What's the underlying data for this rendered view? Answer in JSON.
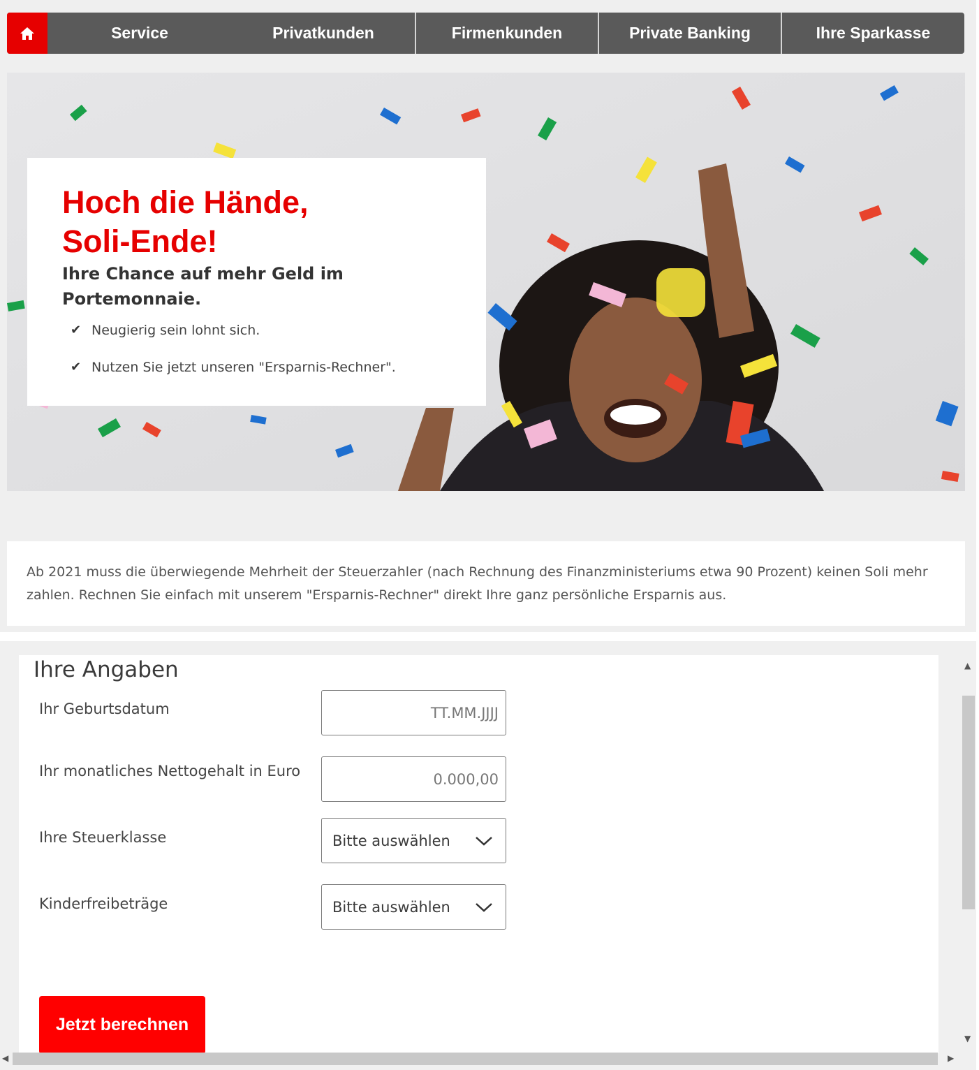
{
  "nav": {
    "home_icon": "home-icon",
    "items": [
      {
        "label": "Service"
      },
      {
        "label": "Privatkunden"
      },
      {
        "label": "Firmenkunden"
      },
      {
        "label": "Private Banking"
      },
      {
        "label": "Ihre Sparkasse"
      }
    ]
  },
  "hero": {
    "image": "woman-with-confetti-photo",
    "headline_line1": "Hoch die Hände,",
    "headline_line2": "Soli-Ende!",
    "subheadline": "Ihre Chance auf mehr Geld im Portemonnaie.",
    "bullets": [
      {
        "icon": "checkmark-icon",
        "text": "Neugierig sein lohnt sich."
      },
      {
        "icon": "checkmark-icon",
        "text": "Nutzen Sie jetzt unseren \"Ersparnis-Rechner\"."
      }
    ]
  },
  "intro": {
    "text": "Ab 2021 muss die überwiegende Mehrheit der Steuerzahler (nach Rechnung des Finanzministeriums etwa 90 Prozent) keinen Soli mehr zahlen. Rechnen Sie einfach mit unserem \"Ersparnis-Rechner\" direkt Ihre ganz persönliche Ersparnis aus."
  },
  "form": {
    "title": "Ihre Angaben",
    "birthdate": {
      "label": "Ihr Geburtsdatum",
      "placeholder": "TT.MM.JJJJ",
      "value": ""
    },
    "salary": {
      "label": "Ihr monatliches Nettogehalt in Euro",
      "placeholder": "0.000,00",
      "value": ""
    },
    "tax_class": {
      "label": "Ihre Steuerklasse",
      "selected": "Bitte auswählen"
    },
    "child_allowance": {
      "label": "Kinderfreibeträge",
      "selected": "Bitte auswählen"
    },
    "submit_label": "Jetzt berechnen"
  },
  "colors": {
    "brand_red": "#e60000",
    "button_red": "#ff0000",
    "nav_gray": "#5a5a5a"
  }
}
